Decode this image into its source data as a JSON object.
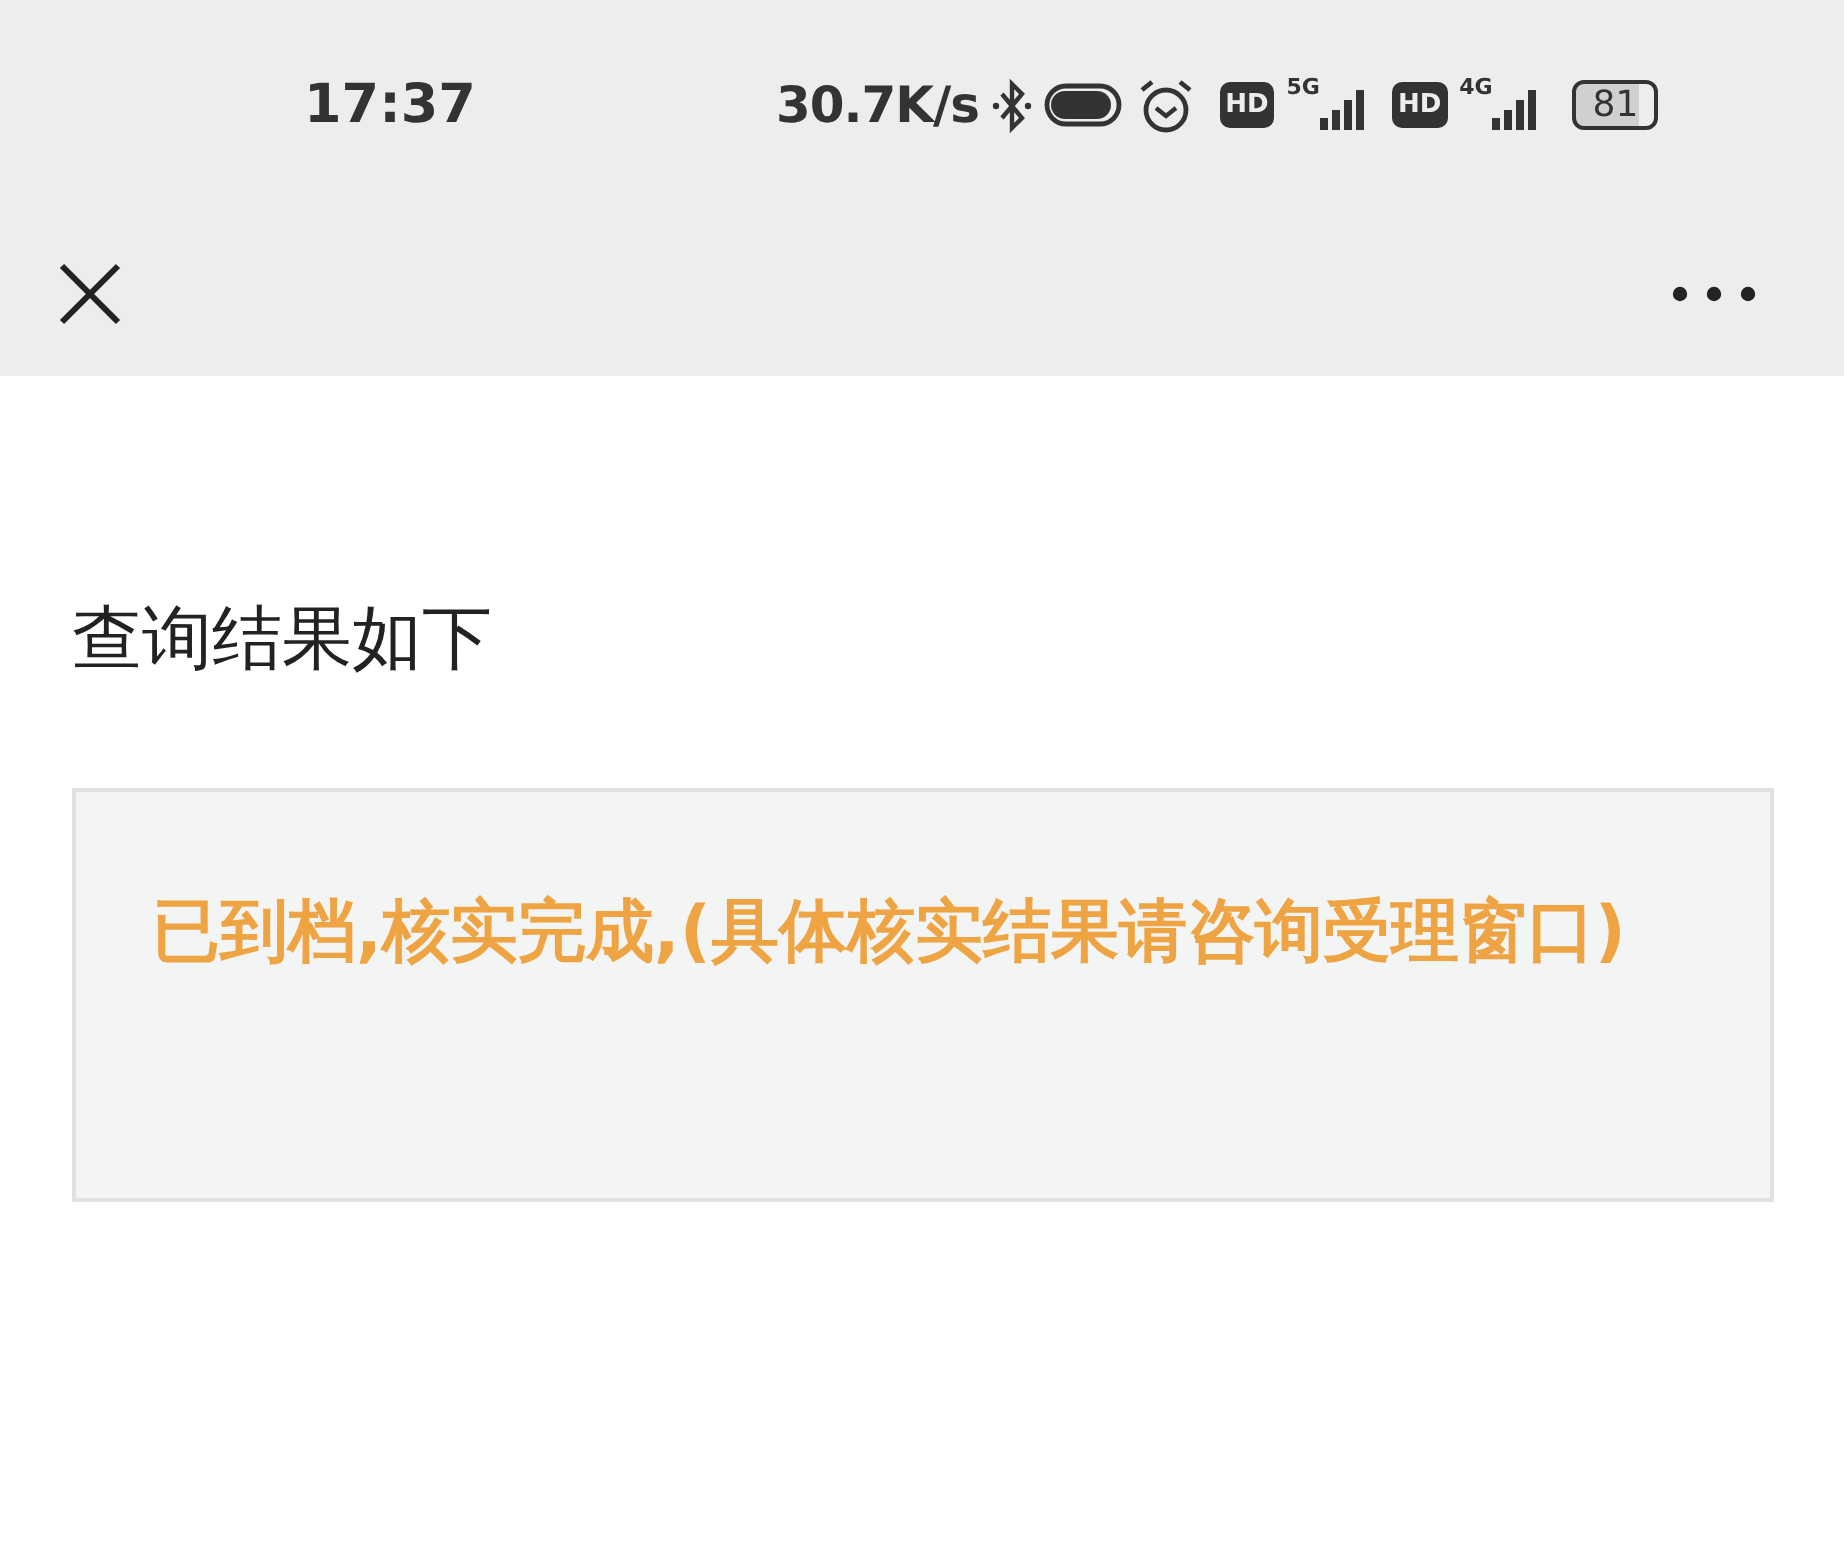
{
  "status_bar": {
    "time": "17:37",
    "speed": "30.7K/s",
    "sims": [
      {
        "hd": "HD",
        "network": "5G"
      },
      {
        "hd": "HD",
        "network": "4G"
      }
    ],
    "battery": "81"
  },
  "heading": "查询结果如下",
  "result": "已到档,核实完成,(具体核实结果请咨询受理窗口)"
}
